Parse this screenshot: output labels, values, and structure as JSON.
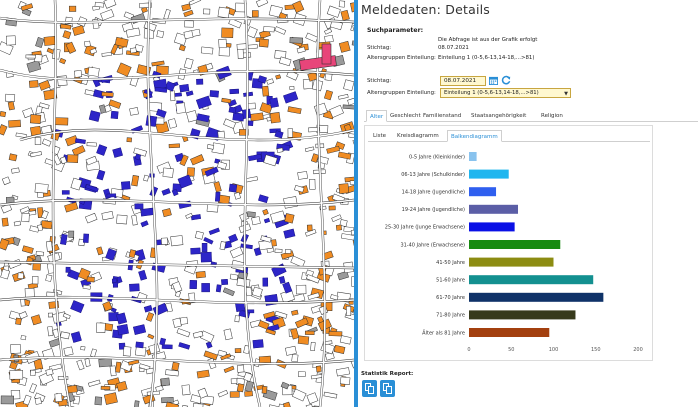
{
  "panel": {
    "title": "Meldedaten: Details",
    "query_section_label": "Suchparameter:",
    "query_source_text": "Die Abfrage ist aus der Grafik erfolgt",
    "stichtag_label": "Stichtag:",
    "stichtag_value": "08.07.2021",
    "altersgruppen_label": "Altersgruppen Einteilung:",
    "altersgruppen_value": "Einteilung 1 (0-5,6-13,14-18,...>81)",
    "form_stichtag_label": "Stichtag:",
    "form_date_value": "08.07.2021",
    "form_altersgruppen_label": "Altersgruppen Einteilung:",
    "form_select_value": "Einteilung 1 (0-5,6-13,14-18,...>81)"
  },
  "tabs": [
    "Alter",
    "Geschlecht",
    "Familienstand",
    "Staatsangehörigkeit",
    "Religion"
  ],
  "subtabs": [
    "Liste",
    "Kreisdiagramm",
    "Balkendiagramm"
  ],
  "statistik": {
    "label": "Statistik Report:"
  },
  "icons": [
    "calendar-icon",
    "refresh-icon",
    "report-pdf-icon",
    "report-export-icon",
    "select-chevron-icon"
  ],
  "colors": {
    "accent": "#2a8fd6",
    "input_bg": "#fff8d0",
    "house_blue": "#2d25c8",
    "building_orange": "#f08c23"
  },
  "chart_data": {
    "type": "bar",
    "orientation": "horizontal",
    "categories": [
      "0-5 Jahre (Kleinkinder)",
      "06-13 Jahre (Schulkinder)",
      "14-18 Jahre (Jugendliche)",
      "19-24 Jahre (Jugendliche)",
      "25-30 Jahre (Junge Erwachsene)",
      "31-40 Jahre (Erwachsene)",
      "41-50 Jahre",
      "51-60 Jahre",
      "61-70 Jahre",
      "71-80 Jahre",
      "Älter als 81 Jahre"
    ],
    "values": [
      9,
      47,
      32,
      58,
      54,
      108,
      100,
      147,
      159,
      126,
      95
    ],
    "colors": [
      "#89c3ee",
      "#1fb6ef",
      "#2f5fef",
      "#5b5ea6",
      "#0a10e6",
      "#178a10",
      "#8c8c12",
      "#139090",
      "#0f3268",
      "#373a1c",
      "#a3400f"
    ],
    "xticks": [
      "0",
      "50",
      "100",
      "150",
      "200"
    ],
    "xlim": [
      0,
      200
    ],
    "grid": false,
    "legend": "none"
  }
}
